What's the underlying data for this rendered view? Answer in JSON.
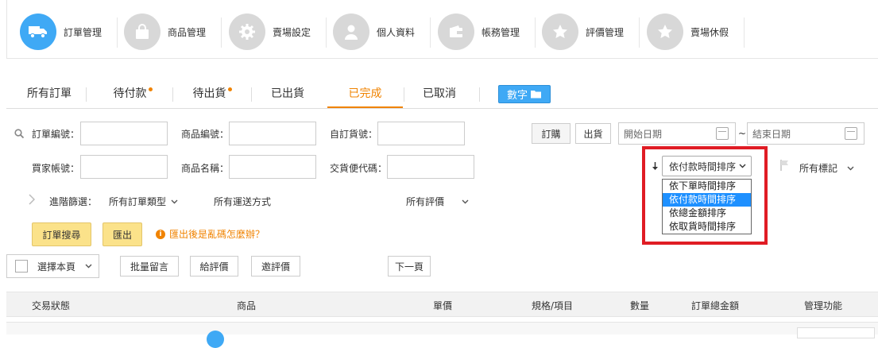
{
  "topnav": {
    "items": [
      {
        "label": "訂單管理",
        "icon": "truck-icon",
        "active": true
      },
      {
        "label": "商品管理",
        "icon": "bag-icon"
      },
      {
        "label": "賣場設定",
        "icon": "gear-icon"
      },
      {
        "label": "個人資料",
        "icon": "user-icon"
      },
      {
        "label": "帳務管理",
        "icon": "wallet-icon"
      },
      {
        "label": "評價管理",
        "icon": "star-icon"
      },
      {
        "label": "賣場休假",
        "icon": "star-icon"
      }
    ]
  },
  "tabs": {
    "items": [
      {
        "label": "所有訂單"
      },
      {
        "label": "待付款"
      },
      {
        "label": "待出貨"
      },
      {
        "label": "已出貨"
      },
      {
        "label": "已完成"
      },
      {
        "label": "已取消"
      }
    ],
    "count_label": "數字"
  },
  "search": {
    "order_no_label": "訂單編號：",
    "product_no_label": "商品編號：",
    "custom_no_label": "自訂貨號：",
    "buyer_label": "買家帳號：",
    "product_name_label": "商品名稱：",
    "pickup_code_label": "交貨便代碼：",
    "order_btn": "訂購",
    "ship_btn": "出貨",
    "start_date": "開始日期",
    "date_sep": "~",
    "end_date": "結束日期",
    "advanced_label": "進階篩選：",
    "order_type": "所有訂單類型",
    "delivery": "所有運送方式",
    "rating": "所有評價",
    "search_btn": "訂單搜尋",
    "export_btn": "匯出",
    "export_help": "匯出後是亂碼怎麼辦？"
  },
  "sort": {
    "selected": "依付款時間排序",
    "options": [
      "依下單時間排序",
      "依付款時間排序",
      "依總金額排序",
      "依取貨時間排序"
    ],
    "flag_label": "所有標記"
  },
  "actions": {
    "select_page": "選擇本頁",
    "batch_msg": "批量留言",
    "give_rating": "給評價",
    "ask_rating": "邀評價",
    "next_page": "下一頁"
  },
  "table": {
    "headers": [
      "交易狀態",
      "商品",
      "單價",
      "規格/項目",
      "數量",
      "訂單總金額",
      "管理功能"
    ]
  }
}
